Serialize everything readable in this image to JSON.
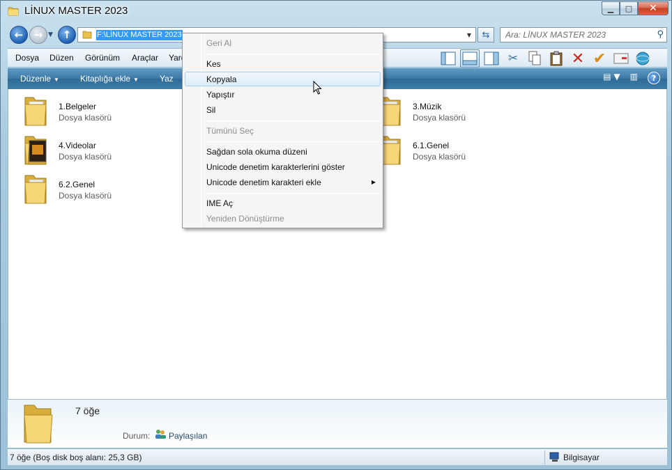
{
  "window": {
    "title": "LİNUX MASTER 2023"
  },
  "caption": {
    "minimize": "▁",
    "maximize": "□",
    "close": "✕"
  },
  "address": {
    "path": "F:\\LİNUX MASTER 2023",
    "search_placeholder": "Ara: LİNUX MASTER 2023"
  },
  "menubar": {
    "items": [
      "Dosya",
      "Düzen",
      "Görünüm",
      "Araçlar",
      "Yard"
    ]
  },
  "commandbar": {
    "organize": "Düzenle",
    "add_library": "Kitaplığa ekle",
    "burn": "Yaz"
  },
  "files": [
    {
      "name": "1.Belgeler",
      "type": "Dosya klasörü"
    },
    {
      "name": "3.Müzik",
      "type": "Dosya klasörü"
    },
    {
      "name": "4.Videolar",
      "type": "Dosya klasörü"
    },
    {
      "name": "6.1.Genel",
      "type": "Dosya klasörü"
    },
    {
      "name": "6.2.Genel",
      "type": "Dosya klasörü"
    }
  ],
  "details": {
    "count": "7 öğe",
    "state_label": "Durum:",
    "state_value": "Paylaşılan"
  },
  "statusbar": {
    "left": "7 öğe (Boş disk boş alanı: 25,3 GB)",
    "right": "Bilgisayar"
  },
  "context_menu": {
    "items": [
      {
        "label": "Geri Al",
        "enabled": false
      },
      {
        "label": "Kes",
        "enabled": true
      },
      {
        "label": "Kopyala",
        "enabled": true,
        "highlighted": true
      },
      {
        "label": "Yapıştır",
        "enabled": true
      },
      {
        "label": "Sil",
        "enabled": true
      },
      {
        "label": "Tümünü Seç",
        "enabled": false
      },
      {
        "label": "Sağdan sola okuma düzeni",
        "enabled": true
      },
      {
        "label": "Unicode denetim karakterlerini göster",
        "enabled": true
      },
      {
        "label": "Unicode denetim karakteri ekle",
        "enabled": true,
        "submenu": true
      },
      {
        "label": "IME Aç",
        "enabled": true
      },
      {
        "label": "Yeniden Dönüştürme",
        "enabled": false
      }
    ]
  },
  "icons": {
    "back": "arrow-left-icon",
    "forward": "arrow-right-icon",
    "up": "arrow-up-icon",
    "search": "search-icon",
    "refresh": "refresh-icon",
    "help": "help-icon"
  },
  "colors": {
    "selection": "#3399ff",
    "command_bar": "#3e7aa6",
    "menu_highlight_border": "#a8d0ee"
  }
}
